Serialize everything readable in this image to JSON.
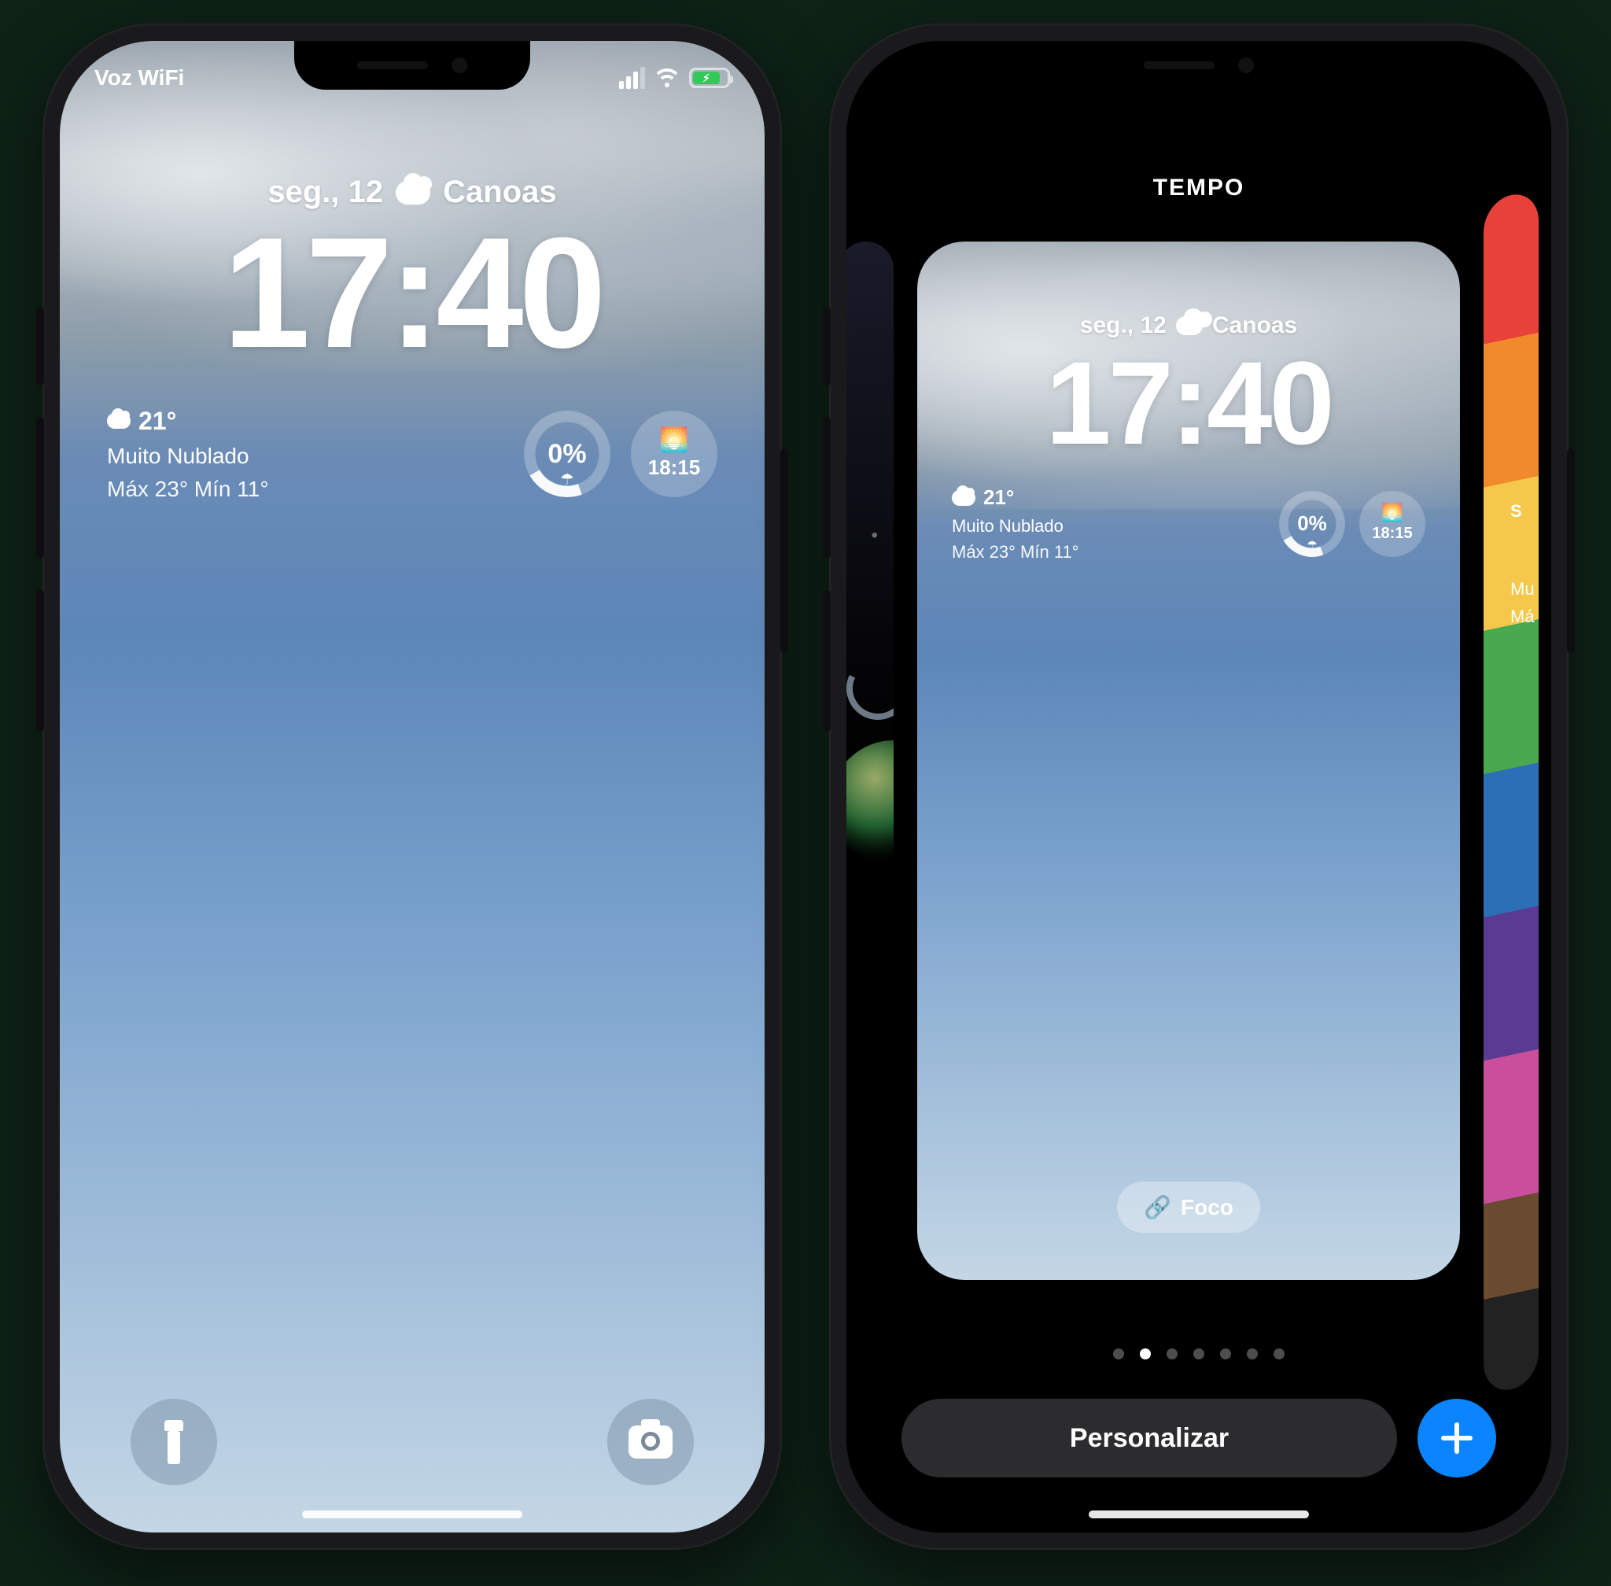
{
  "status": {
    "carrier": "Voz WiFi"
  },
  "lock": {
    "date": "seg., 12",
    "location": "Canoas",
    "time": "17:40",
    "temp": "21°",
    "condition": "Muito Nublado",
    "range": "Máx 23° Mín 11°",
    "precip": "0%",
    "sunset": "18:15"
  },
  "gallery": {
    "title": "TEMPO",
    "focus_label": "Foco",
    "customize": "Personalizar",
    "page_count": 7,
    "active_page": 1,
    "right_peek_line1": "Mu",
    "right_peek_line2": "Má"
  }
}
